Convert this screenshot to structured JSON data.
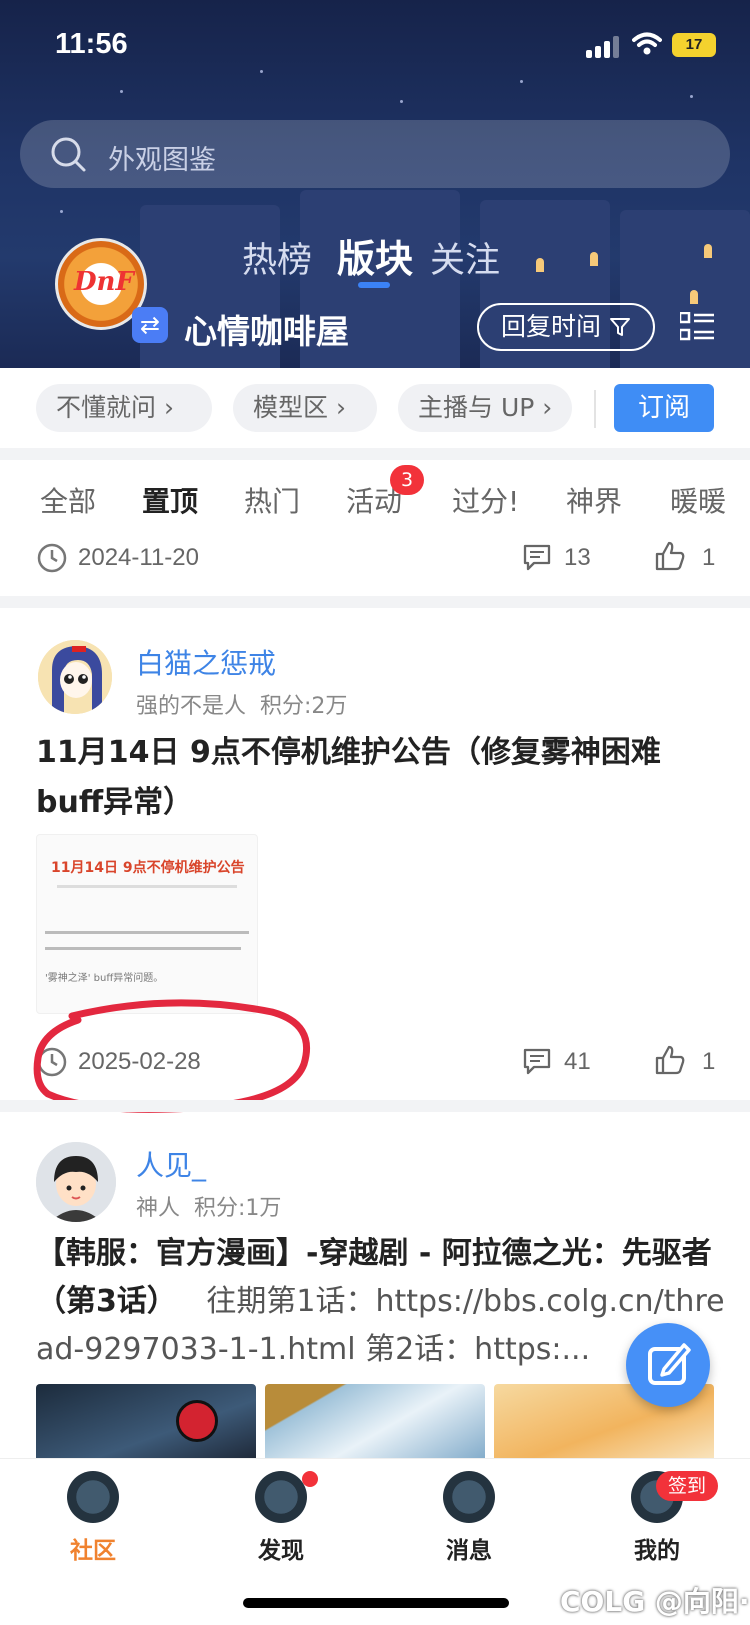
{
  "status_bar": {
    "time": "11:56",
    "battery": "17"
  },
  "search": {
    "placeholder": "外观图鉴"
  },
  "header": {
    "logo_text": "DnF",
    "tabs": [
      {
        "label": "热榜"
      },
      {
        "label": "版块"
      },
      {
        "label": "关注"
      }
    ],
    "forum_name": "心情咖啡屋",
    "sort_label": "回复时间"
  },
  "chips": [
    {
      "label": "不懂就问"
    },
    {
      "label": "模型区"
    },
    {
      "label": "主播与 UP"
    }
  ],
  "subscribe_label": "订阅",
  "categories": [
    {
      "label": "全部"
    },
    {
      "label": "置顶"
    },
    {
      "label": "热门"
    },
    {
      "label": "活动"
    },
    {
      "label": "过分!"
    },
    {
      "label": "神界"
    },
    {
      "label": "暖暖"
    }
  ],
  "activity_badge": "3",
  "posts": [
    {
      "date": "2024-11-20",
      "comments": "13",
      "likes": "1"
    },
    {
      "author": "白猫之惩戒",
      "rank": "强的不是人",
      "points": "积分:2万",
      "title": "11月14日  9点不停机维护公告（修复雾神困难buff异常）",
      "thumb_title": "11月14日 9点不停机维护公告",
      "thumb_line": "'雾神之泽' buff异常问题。",
      "date": "2025-02-28",
      "comments": "41",
      "likes": "1"
    },
    {
      "author": "人见_",
      "rank": "神人",
      "points": "积分:1万",
      "title": "【韩服：官方漫画】-穿越剧 - 阿拉德之光：先驱者（第3话）",
      "excerpt": "往期第1话：https://bbs.colg.cn/thread-9297033-1-1.html 第2话：https:..."
    }
  ],
  "nav": [
    {
      "label": "社区"
    },
    {
      "label": "发现"
    },
    {
      "label": "消息"
    },
    {
      "label": "我的"
    }
  ],
  "sign_in_badge": "签到",
  "watermark": "COLG @向阳·",
  "colors": {
    "accent": "#3f8df5",
    "active_nav": "#f0822f",
    "annotation": "#e3283f"
  }
}
